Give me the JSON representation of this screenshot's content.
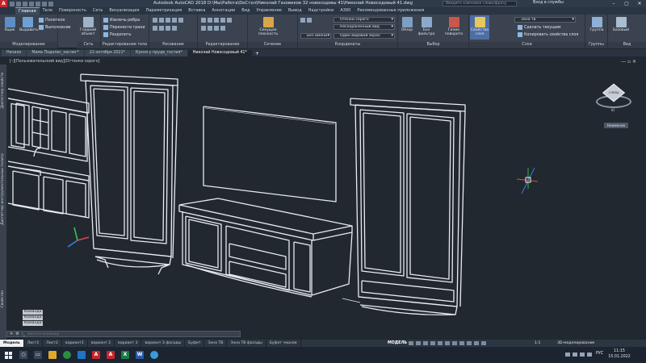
{
  "window": {
    "title": "Autodesk AutoCAD 2018   D:\\Мы\\Работа\\DeСтол\\Николай Газовиков 32 новосодовы 41\\Николай Новосодовый 41.dwg",
    "search_placeholder": "Введите ключевое слово/фразу",
    "user": "Вход в службы"
  },
  "ribbon_tabs": [
    "Главная",
    "Тело",
    "Поверхность",
    "Сеть",
    "Визуализация",
    "Параметризация",
    "Вставка",
    "Аннотации",
    "Вид",
    "Управление",
    "Вывод",
    "Надстройки",
    "A360",
    "Рекомендованные приложения"
  ],
  "ribbon": {
    "modeling": {
      "title": "Моделирование",
      "btn_box": "Ящик",
      "btn_extrude": "Выдавить",
      "row_polysolid": "Политело",
      "row_sweep": "Выполнение"
    },
    "mesh": {
      "title": "Сеть",
      "btn_smooth": "Гладкий объект"
    },
    "solid_editing": {
      "title": "Редактирование тела",
      "row_fillet": "Извлечь ребра",
      "row_extract": "Перенести грани",
      "row_split": "Разделить"
    },
    "draw": {
      "title": "Рисование"
    },
    "modify": {
      "title": "Редактирование"
    },
    "section": {
      "title": "Сечение",
      "btn_plane": "Секущая плоскость"
    },
    "coords": {
      "title": "Координаты",
      "combo_visual": "Отенки серого",
      "combo_view": "Несохраненный вид",
      "combo_filter": "Без имени",
      "combo_viewport": "Один видовой экран"
    },
    "selection": {
      "title": "Выбор",
      "btn_gizmo": "Обзор",
      "btn_filter": "Без фильтра",
      "btn_culling": "Гизмо поворота"
    },
    "layers": {
      "title": "Слои",
      "btn_props": "Свойства слоя",
      "combo_layer": "Зона тв",
      "row_make_current": "Сделать текущим",
      "row_match": "Копировать свойства слоя"
    },
    "groups": {
      "title": "Группы",
      "btn_group": "Группа"
    },
    "view": {
      "title": "Вид",
      "btn_base": "Базовый"
    }
  },
  "file_tabs": [
    "Начало",
    "Мама Подолес_кеслег*",
    "22 октября 2021*",
    "Кухня у прудв_гостия*",
    "Николай Новосодовый 41*"
  ],
  "file_tab_active": 4,
  "viewport": {
    "label": "[–][Пользовательский вид][Оттенки серого]",
    "viewcube_label": "СЛЕВА",
    "wcs": "Неименов",
    "palette_labels": [
      "Диспетчер свойств",
      "Диспетчер инструментальных палитр",
      "Свойства"
    ]
  },
  "command": {
    "history": [
      "Команда:",
      "Команда:",
      "Команда:"
    ],
    "placeholder": "Ввести команду"
  },
  "layout_tabs": [
    "Модель",
    "Лист1",
    "Лист2",
    "вариант1",
    "вариант 2",
    "вариант 3",
    "вариант 3 фасады",
    "Буфет",
    "Зона ТВ",
    "Зона ТВ фасады",
    "Буфет черная"
  ],
  "layout_active": 0,
  "status": {
    "model": "МОДЕЛЬ",
    "scale": "1:1",
    "workspace": "3D-моделирование"
  },
  "taskbar": {
    "lang": "РУС",
    "time": "11:15",
    "date": "15.01.2022",
    "apps": [
      {
        "name": "search",
        "color": "#3a4658",
        "glyph": "○"
      },
      {
        "name": "taskview",
        "color": "#3a4658",
        "glyph": "▭"
      },
      {
        "name": "explorer",
        "color": "#e0a92a",
        "glyph": ""
      },
      {
        "name": "chrome",
        "color": "#2c8d43",
        "glyph": ""
      },
      {
        "name": "mail",
        "color": "#1f74c4",
        "glyph": ""
      },
      {
        "name": "autocad-1",
        "color": "#c8242b",
        "glyph": "A"
      },
      {
        "name": "autocad-2",
        "color": "#c8242b",
        "glyph": "A"
      },
      {
        "name": "excel",
        "color": "#1f7a45",
        "glyph": "X"
      },
      {
        "name": "word",
        "color": "#2d5aa6",
        "glyph": "W"
      },
      {
        "name": "telegram",
        "color": "#3a9bd8",
        "glyph": ""
      }
    ]
  },
  "colors": {
    "accent": "#7fa8d8",
    "autocad_red": "#c8242b",
    "viewport_bg": "#212830"
  }
}
